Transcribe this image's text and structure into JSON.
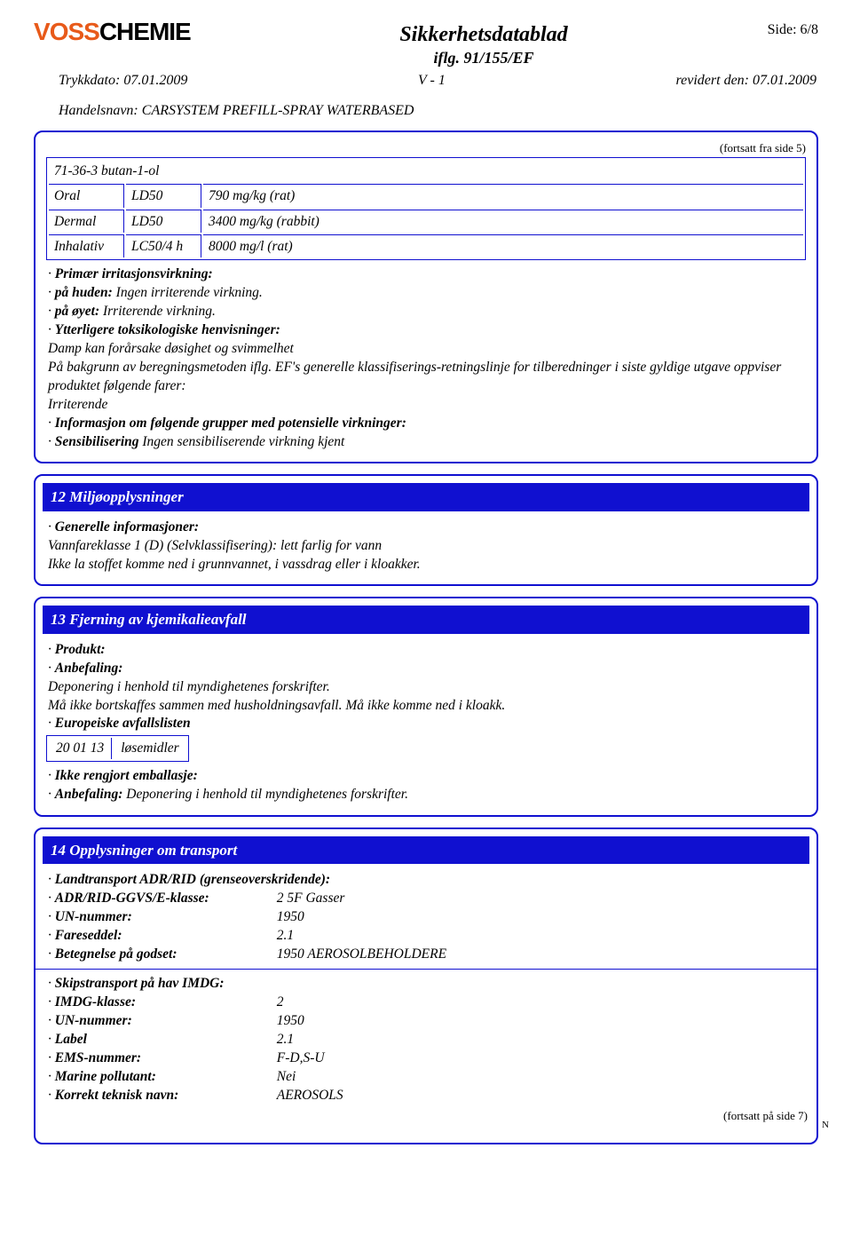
{
  "header": {
    "logo_v": "V",
    "logo_oss": "OSS",
    "logo_chemie": "CHEMIE",
    "title": "Sikkerhetsdatablad",
    "subtitle": "iflg. 91/155/EF",
    "page": "Side: 6/8",
    "print_label": "Trykkdato:",
    "print_date": "07.01.2009",
    "version": "V - 1",
    "rev_label": "revidert den:",
    "rev_date": "07.01.2009",
    "handelsnavn_label": "Handelsnavn:",
    "handelsnavn_value": "CARSYSTEM PREFILL-SPRAY WATERBASED"
  },
  "cont_from": "(fortsatt fra side 5)",
  "tox": {
    "cas": "71-36-3 butan-1-ol",
    "rows": [
      [
        "Oral",
        "LD50",
        "790 mg/kg (rat)"
      ],
      [
        "Dermal",
        "LD50",
        "3400 mg/kg (rabbit)"
      ],
      [
        "Inhalativ",
        "LC50/4 h",
        "8000 mg/l (rat)"
      ]
    ],
    "primirr_label": "Primær irritasjonsvirkning:",
    "hud_label": "på huden:",
    "hud_val": " Ingen irriterende virkning.",
    "oye_label": "på øyet:",
    "oye_val": " Irriterende virkning.",
    "ytt_label": "Ytterligere toksikologiske henvisninger:",
    "ytt_line1": "Damp kan forårsake døsighet og svimmelhet",
    "ytt_line2": "På bakgrunn av beregningsmetoden iflg. EF's generelle klassifiserings-retningslinje for tilberedninger i siste gyldige utgave oppviser produktet følgende farer:",
    "ytt_line3": "Irriterende",
    "info_label": "Informasjon om følgende grupper med potensielle virkninger:",
    "sens_label": "Sensibilisering",
    "sens_val": " Ingen sensibiliserende virkning kjent"
  },
  "s12": {
    "title": "12 Miljøopplysninger",
    "gen_label": "Generelle informasjoner:",
    "gen_line1": "Vannfareklasse 1 (D) (Selvklassifisering): lett farlig for vann",
    "gen_line2": "Ikke la stoffet komme ned i grunnvannet, i vassdrag eller i kloakker."
  },
  "s13": {
    "title": "13 Fjerning av kjemikalieavfall",
    "prod_label": "Produkt:",
    "anbef_label": "Anbefaling:",
    "anbef_line1": "Deponering i henhold til myndighetenes forskrifter.",
    "anbef_line2": "Må ikke bortskaffes sammen med husholdningsavfall. Må ikke komme ned i kloakk.",
    "euro_label": "Europeiske avfallslisten",
    "waste_code": "20 01 13",
    "waste_name": "løsemidler",
    "emb_label": "Ikke rengjort emballasje:",
    "emb_anbef_label": "Anbefaling:",
    "emb_anbef_val": " Deponering i henhold til myndighetenes forskrifter."
  },
  "s14": {
    "title": "14 Opplysninger om transport",
    "land_label": "Landtransport ADR/RID (grenseoverskridende):",
    "adr_label": "ADR/RID-GGVS/E-klasse:",
    "adr_val": "2   5F Gasser",
    "un_label": "UN-nummer:",
    "un_val": "1950",
    "fare_label": "Fareseddel:",
    "fare_val": "2.1",
    "bet_label": "Betegnelse på godset:",
    "bet_val": "1950 AEROSOLBEHOLDERE",
    "sea_label": "Skipstransport på hav IMDG:",
    "imdg_label": "IMDG-klasse:",
    "imdg_val": "2",
    "un2_label": "UN-nummer:",
    "un2_val": "1950",
    "labl_label": "Label",
    "labl_val": "2.1",
    "ems_label": "EMS-nummer:",
    "ems_val": "F-D,S-U",
    "mp_label": "Marine pollutant:",
    "mp_val": "Nei",
    "kt_label": "Korrekt teknisk navn:",
    "kt_val": "AEROSOLS"
  },
  "cont_to": "(fortsatt på side 7)",
  "corner": "N"
}
